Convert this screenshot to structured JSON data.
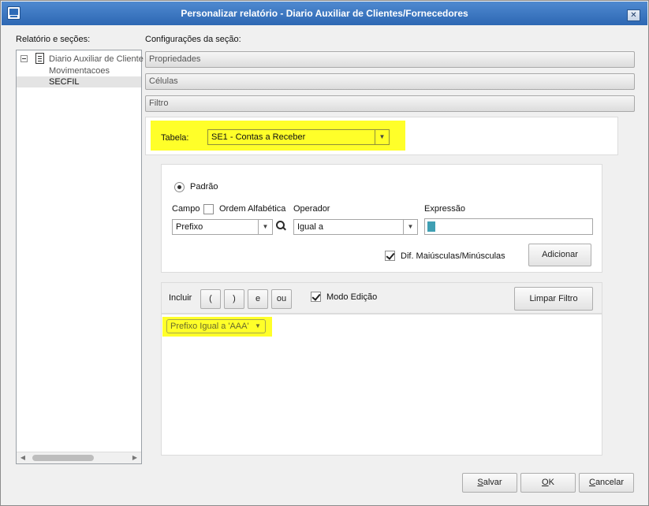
{
  "window": {
    "title": "Personalizar relatório - Diario Auxiliar de Clientes/Fornecedores",
    "close_glyph": "✕"
  },
  "left": {
    "label": "Relatório e seções:",
    "tree": [
      {
        "label": "Diario Auxiliar de Cliente",
        "icon": "document-icon",
        "expanded": true
      },
      {
        "label": "Movimentacoes"
      },
      {
        "label": "SECFIL",
        "selected": true
      }
    ]
  },
  "config": {
    "label": "Configurações da seção:",
    "sections": [
      "Propriedades",
      "Células",
      "Filtro"
    ]
  },
  "tabela": {
    "label": "Tabela:",
    "value": "SE1 - Contas a Receber"
  },
  "filtro": {
    "padrao_label": "Padrão",
    "campo_label": "Campo",
    "ordem_label": "Ordem Alfabética",
    "operador_label": "Operador",
    "expressao_label": "Expressão",
    "campo_value": "Prefixo",
    "operador_value": "Igual a",
    "dif_label": "Dif. Maiúsculas/Minúsculas",
    "adicionar_label": "Adicionar"
  },
  "incluir": {
    "label": "Incluir",
    "buttons": [
      "(",
      ")",
      "e",
      "ou"
    ],
    "modo_label": "Modo Edição",
    "limpar_label": "Limpar Filtro",
    "expression": "Prefixo Igual a 'AAA'"
  },
  "footer": {
    "salvar_rest": "alvar",
    "ok_rest": "K",
    "cancelar_rest": "ancelar",
    "salvar_key": "S",
    "ok_key": "O",
    "cancelar_key": "C"
  },
  "colors": {
    "highlight": "#ffff29",
    "titlebar": "#2d67b3",
    "accent_cursor": "#3f9fb3"
  }
}
